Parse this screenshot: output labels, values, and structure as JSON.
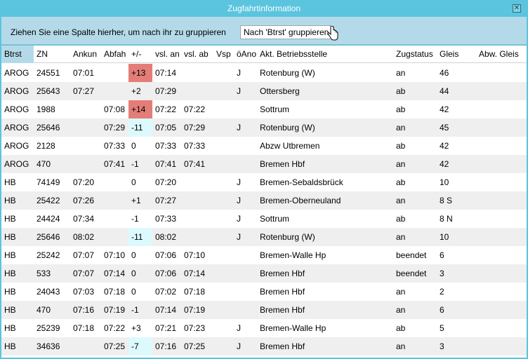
{
  "window": {
    "title": "Zugfahrtinformation",
    "close_glyph": "✕"
  },
  "groupbar": {
    "hint": "Ziehen Sie eine Spalte hierher, um nach ihr zu gruppieren",
    "button_label": "Nach 'Btrst' gruppieren"
  },
  "columns": [
    "Btrst",
    "ZN",
    "Ankun",
    "Abfah",
    "+/-",
    "vsl. an",
    "vsl. ab",
    "Vsp",
    "öAno",
    "Akt. Betriebsstelle",
    "Zugstatus",
    "Gleis",
    "Abw. Gleis"
  ],
  "rows": [
    {
      "btrst": "AROG",
      "zn": "24551",
      "ankun": "07:01",
      "abfah": "",
      "delay": "+13",
      "delay_state": "late",
      "vsl_an": "07:14",
      "vsl_ab": "",
      "vsp": "",
      "oano": "J",
      "stelle": "Rotenburg (W)",
      "status": "an",
      "gleis": "46",
      "abw": ""
    },
    {
      "btrst": "AROG",
      "zn": "25643",
      "ankun": "07:27",
      "abfah": "",
      "delay": "+2",
      "delay_state": "",
      "vsl_an": "07:29",
      "vsl_ab": "",
      "vsp": "",
      "oano": "J",
      "stelle": "Ottersberg",
      "status": "ab",
      "gleis": "44",
      "abw": ""
    },
    {
      "btrst": "AROG",
      "zn": "1988",
      "ankun": "",
      "abfah": "07:08",
      "delay": "+14",
      "delay_state": "late",
      "vsl_an": "07:22",
      "vsl_ab": "07:22",
      "vsp": "",
      "oano": "",
      "stelle": "Sottrum",
      "status": "ab",
      "gleis": "42",
      "abw": ""
    },
    {
      "btrst": "AROG",
      "zn": "25646",
      "ankun": "",
      "abfah": "07:29",
      "delay": "-11",
      "delay_state": "early",
      "vsl_an": "07:05",
      "vsl_ab": "07:29",
      "vsp": "",
      "oano": "J",
      "stelle": "Rotenburg (W)",
      "status": "an",
      "gleis": "45",
      "abw": ""
    },
    {
      "btrst": "AROG",
      "zn": "2128",
      "ankun": "",
      "abfah": "07:33",
      "delay": "0",
      "delay_state": "",
      "vsl_an": "07:33",
      "vsl_ab": "07:33",
      "vsp": "",
      "oano": "",
      "stelle": "Abzw Utbremen",
      "status": "ab",
      "gleis": "42",
      "abw": ""
    },
    {
      "btrst": "AROG",
      "zn": "470",
      "ankun": "",
      "abfah": "07:41",
      "delay": "-1",
      "delay_state": "",
      "vsl_an": "07:41",
      "vsl_ab": "07:41",
      "vsp": "",
      "oano": "",
      "stelle": "Bremen Hbf",
      "status": "an",
      "gleis": "42",
      "abw": ""
    },
    {
      "btrst": "HB",
      "zn": "74149",
      "ankun": "07:20",
      "abfah": "",
      "delay": "0",
      "delay_state": "",
      "vsl_an": "07:20",
      "vsl_ab": "",
      "vsp": "",
      "oano": "J",
      "stelle": "Bremen-Sebaldsbrück",
      "status": "ab",
      "gleis": "10",
      "abw": ""
    },
    {
      "btrst": "HB",
      "zn": "25422",
      "ankun": "07:26",
      "abfah": "",
      "delay": "+1",
      "delay_state": "",
      "vsl_an": "07:27",
      "vsl_ab": "",
      "vsp": "",
      "oano": "J",
      "stelle": "Bremen-Oberneuland",
      "status": "an",
      "gleis": "8 S",
      "abw": ""
    },
    {
      "btrst": "HB",
      "zn": "24424",
      "ankun": "07:34",
      "abfah": "",
      "delay": "-1",
      "delay_state": "",
      "vsl_an": "07:33",
      "vsl_ab": "",
      "vsp": "",
      "oano": "J",
      "stelle": "Sottrum",
      "status": "ab",
      "gleis": "8 N",
      "abw": ""
    },
    {
      "btrst": "HB",
      "zn": "25646",
      "ankun": "08:02",
      "abfah": "",
      "delay": "-11",
      "delay_state": "early",
      "vsl_an": "08:02",
      "vsl_ab": "",
      "vsp": "",
      "oano": "J",
      "stelle": "Rotenburg (W)",
      "status": "an",
      "gleis": "10",
      "abw": ""
    },
    {
      "btrst": "HB",
      "zn": "25242",
      "ankun": "07:07",
      "abfah": "07:10",
      "delay": "0",
      "delay_state": "",
      "vsl_an": "07:06",
      "vsl_ab": "07:10",
      "vsp": "",
      "oano": "",
      "stelle": "Bremen-Walle Hp",
      "status": "beendet",
      "gleis": "6",
      "abw": ""
    },
    {
      "btrst": "HB",
      "zn": "533",
      "ankun": "07:07",
      "abfah": "07:14",
      "delay": "0",
      "delay_state": "",
      "vsl_an": "07:06",
      "vsl_ab": "07:14",
      "vsp": "",
      "oano": "",
      "stelle": "Bremen Hbf",
      "status": "beendet",
      "gleis": "3",
      "abw": ""
    },
    {
      "btrst": "HB",
      "zn": "24043",
      "ankun": "07:03",
      "abfah": "07:18",
      "delay": "0",
      "delay_state": "",
      "vsl_an": "07:02",
      "vsl_ab": "07:18",
      "vsp": "",
      "oano": "",
      "stelle": "Bremen Hbf",
      "status": "an",
      "gleis": "2",
      "abw": ""
    },
    {
      "btrst": "HB",
      "zn": "470",
      "ankun": "07:16",
      "abfah": "07:19",
      "delay": "-1",
      "delay_state": "",
      "vsl_an": "07:14",
      "vsl_ab": "07:19",
      "vsp": "",
      "oano": "",
      "stelle": "Bremen Hbf",
      "status": "an",
      "gleis": "6",
      "abw": ""
    },
    {
      "btrst": "HB",
      "zn": "25239",
      "ankun": "07:18",
      "abfah": "07:22",
      "delay": "+3",
      "delay_state": "",
      "vsl_an": "07:21",
      "vsl_ab": "07:23",
      "vsp": "",
      "oano": "J",
      "stelle": "Bremen-Walle Hp",
      "status": "ab",
      "gleis": "5",
      "abw": ""
    },
    {
      "btrst": "HB",
      "zn": "34636",
      "ankun": "",
      "abfah": "07:25",
      "delay": "-7",
      "delay_state": "early",
      "vsl_an": "07:16",
      "vsl_ab": "07:25",
      "vsp": "",
      "oano": "J",
      "stelle": "Bremen Hbf",
      "status": "an",
      "gleis": "3",
      "abw": ""
    }
  ]
}
